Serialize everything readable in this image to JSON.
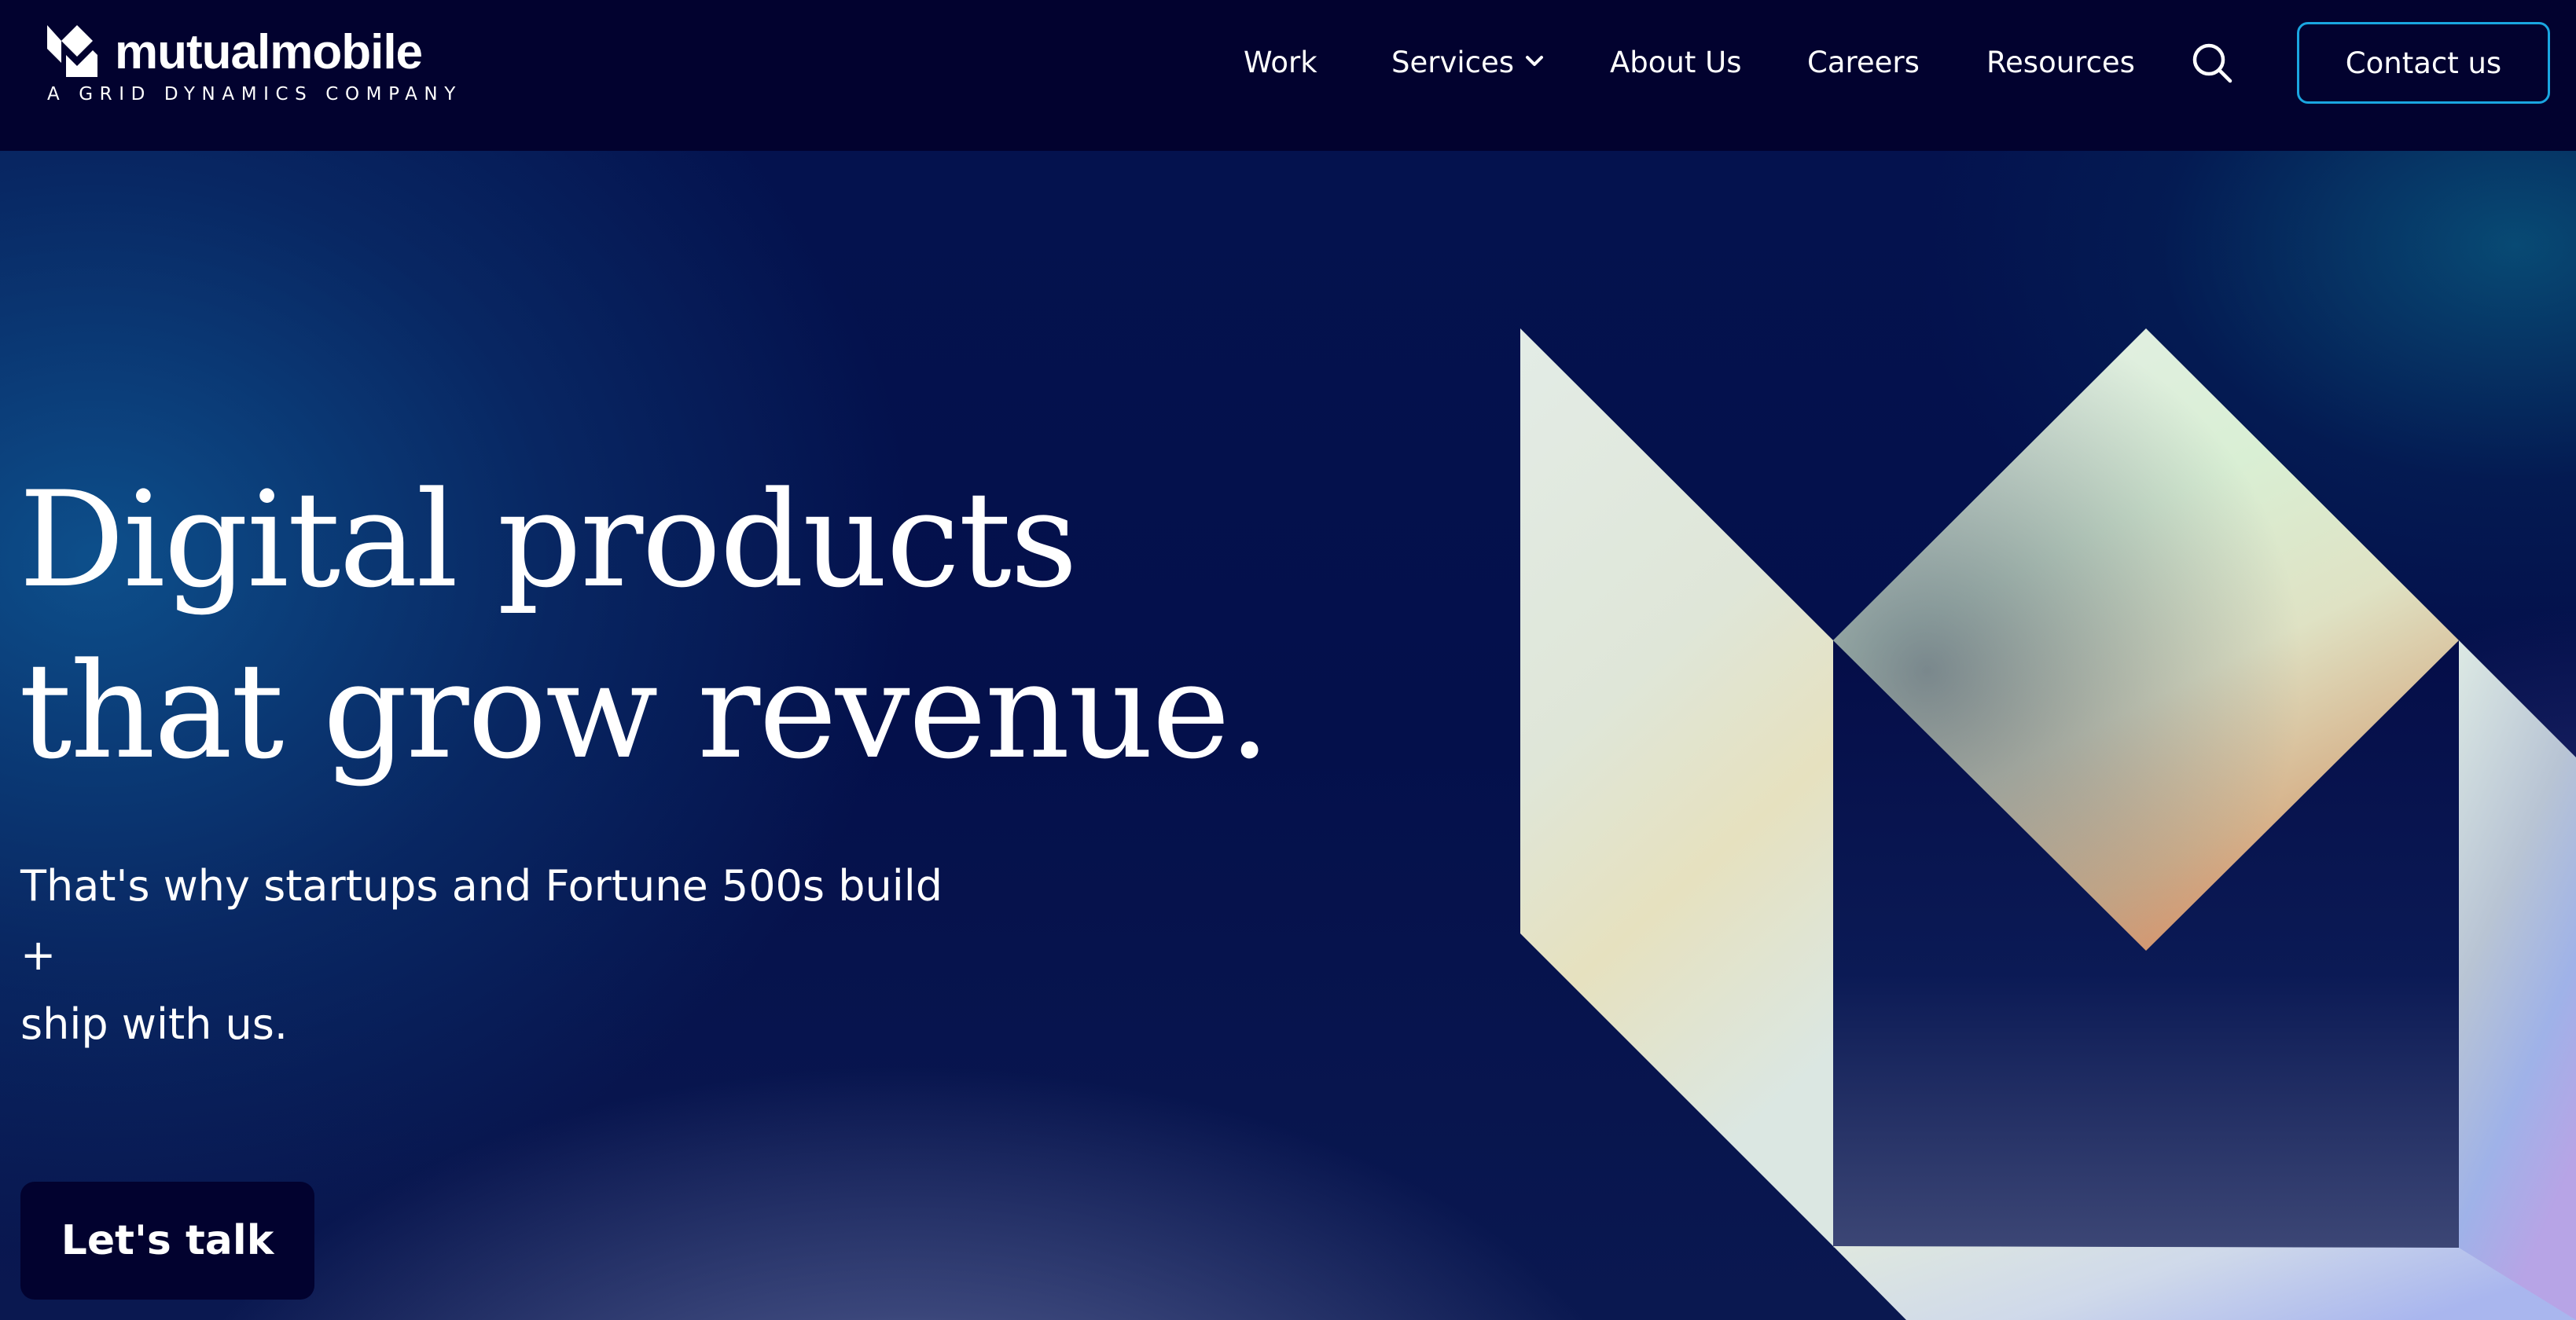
{
  "header": {
    "logo": {
      "wordmark": "mutualmobile",
      "tagline": "A GRID DYNAMICS COMPANY"
    },
    "nav": [
      {
        "label": "Work"
      },
      {
        "label": "Services",
        "has_dropdown": true
      },
      {
        "label": "About Us"
      },
      {
        "label": "Careers"
      },
      {
        "label": "Resources"
      }
    ],
    "search_icon": "search-icon",
    "contact_button": "Contact us"
  },
  "hero": {
    "title_line1": "Digital products",
    "title_line2": "that grow revenue.",
    "subtitle_line1": "That's why startups and Fortune 500s build +",
    "subtitle_line2": "ship with us.",
    "cta_label": "Let's talk"
  },
  "colors": {
    "header_bg": "#02022f",
    "accent_border": "#1aa6e0",
    "text": "#ffffff"
  }
}
